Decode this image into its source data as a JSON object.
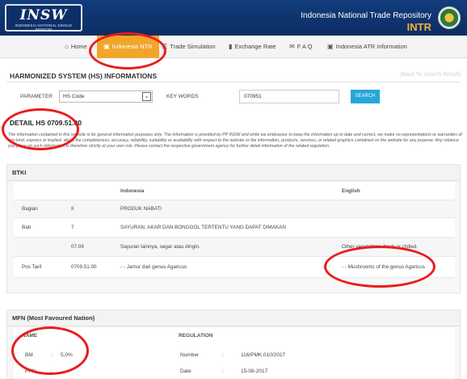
{
  "header": {
    "logo_main": "INSW",
    "logo_sub": "INDONESIA NATIONAL SINGLE WINDOW",
    "repo_title": "Indonesia National Trade Repository",
    "repo_short": "INTR"
  },
  "nav": {
    "items": [
      {
        "label": "Home",
        "icon": "home-icon"
      },
      {
        "label": "Indonesia NTR",
        "icon": "document-icon"
      },
      {
        "label": "Trade Simulation",
        "icon": "list-icon"
      },
      {
        "label": "Exchange Rate",
        "icon": "bar-chart-icon"
      },
      {
        "label": "F A Q",
        "icon": "envelope-icon"
      },
      {
        "label": "Indonesia ATR Information",
        "icon": "document-icon"
      }
    ],
    "active_index": 1,
    "active_color": "#f2a52b"
  },
  "hs_section": {
    "title": "HARMONIZED SYSTEM (HS) INFORMATIONS",
    "back_link": "[Back To Search Result]",
    "param_label": "PARAMETER",
    "param_value": "HS Code",
    "keywords_label": "KEY WORDS",
    "keywords_value": "070951",
    "search_label": "SEARCH"
  },
  "detail": {
    "title": "DETAIL HS 0709.51.00",
    "disclaimer": "The information contained in this website is for general information purposes only. The information is provided by PP INSW and while we endeavour to keep the information up to date and correct, we make no representations or warranties of any kind, express or implied, about the completeness, accuracy, reliability, suitability or availability with respect to the website or the information, products, services, or related graphics contained on the website for any purpose. Any reliance you place on such information is therefore strictly at your own risk. Please contact the respective government agency for further detail information of the related regulation."
  },
  "btki": {
    "title": "BTKI",
    "headers": {
      "indonesia": "Indonesia",
      "english": "English"
    },
    "rows": [
      {
        "label": "Bagian",
        "code": "II",
        "indonesia": "PRODUK NABATI",
        "english": ""
      },
      {
        "label": "Bab",
        "code": "7",
        "indonesia": "SAYURAN, AKAR DAN BONGGOL TERTENTU YANG DAPAT DIMAKAN",
        "english": ""
      },
      {
        "label": "",
        "code": "07.09",
        "indonesia": "Sayuran lainnya, segar atau dingin.",
        "english": "Other vegetables, fresh or chilled."
      },
      {
        "label": "Pos Tarif",
        "code": "0709.51.00",
        "indonesia": "- - Jamur dari genus Agaricus",
        "english": "- - Mushrooms of the genus Agaricus"
      }
    ]
  },
  "mfn": {
    "title": "MFN (Most Favoured Nation)",
    "col_name": "NAME",
    "col_regulation": "REGULATION",
    "rows": [
      {
        "name": "BM",
        "sep": ":",
        "value": "5,0%",
        "reg_label": "Number",
        "reg_sep": ":",
        "reg_value": "116/PMK.010/2017"
      },
      {
        "name": "PPN",
        "sep": ":",
        "value": "",
        "reg_label": "Date",
        "reg_sep": ":",
        "reg_value": "15-08-2017"
      }
    ]
  },
  "colors": {
    "header_bg": "#123c7c",
    "intr_accent": "#f5b13a",
    "search_button": "#25a6d8",
    "annotation_red": "#ea1c1c"
  }
}
